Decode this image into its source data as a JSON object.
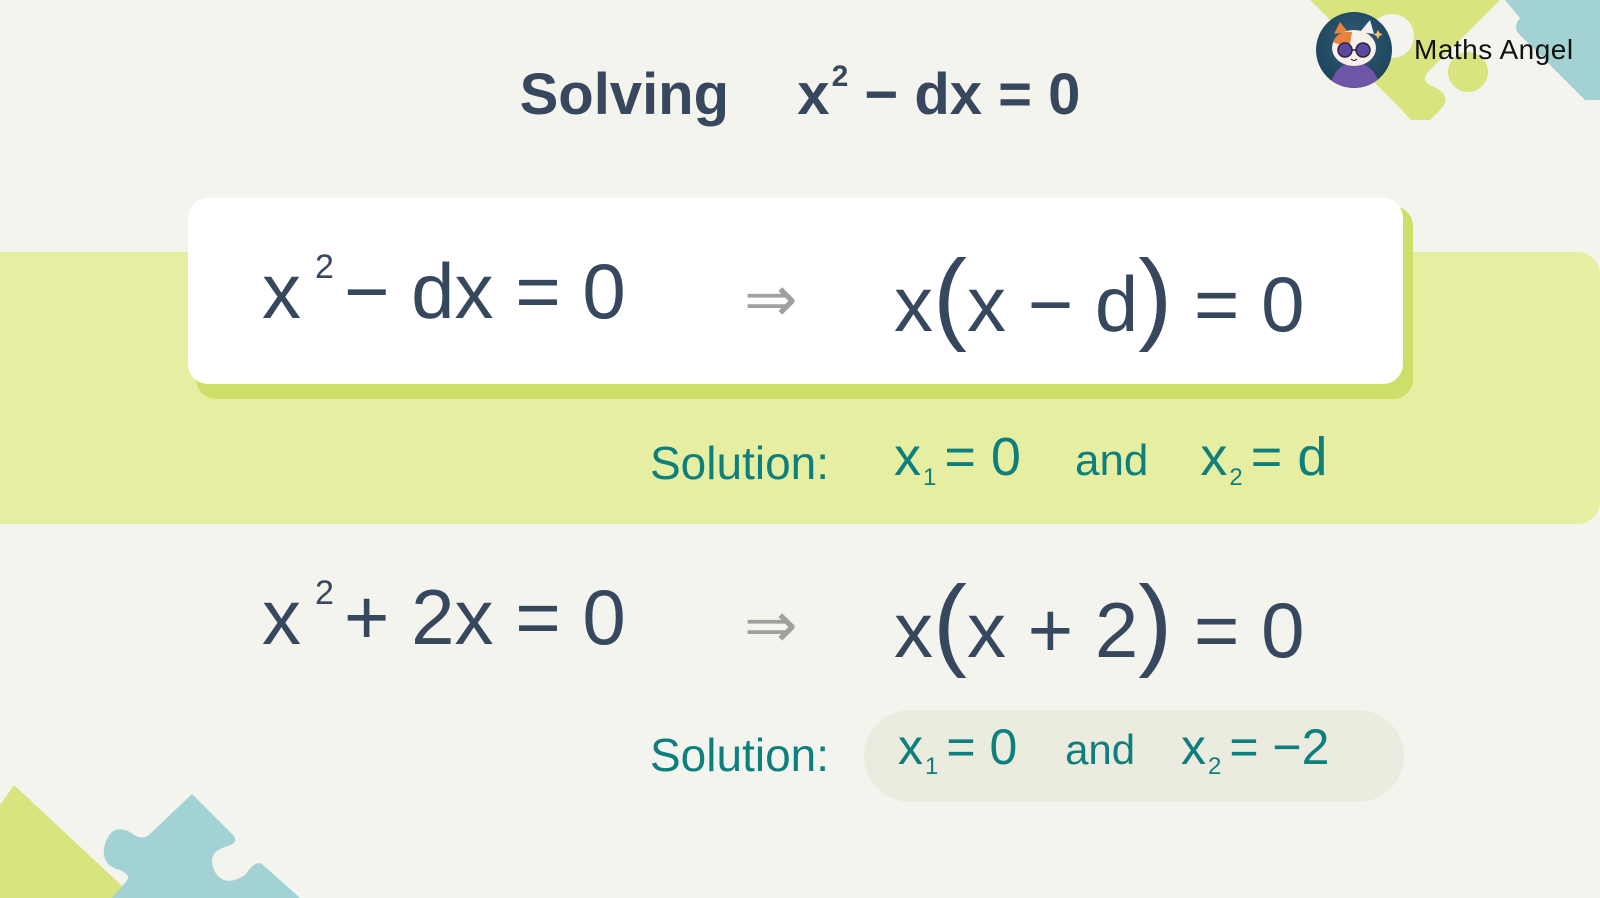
{
  "brand": {
    "name": "Maths Angel",
    "logo_icon": "cat-with-sunglasses-avatar"
  },
  "title": {
    "prefix": "Solving",
    "equation_base": "x",
    "exponent": "2",
    "equation_rest": "− dx = 0"
  },
  "examples": [
    {
      "lhs_base": "x",
      "lhs_exponent": "2",
      "lhs_rest": "− dx = 0",
      "arrow": "⇒",
      "factored_outer": "x",
      "factored_open": "(",
      "factored_inner": "x − d",
      "factored_close": ")",
      "factored_rhs": "= 0",
      "solution_label": "Solution:",
      "x1_var": "x",
      "x1_sub": "1",
      "x1_val": "= 0",
      "and": "and",
      "x2_var": "x",
      "x2_sub": "2",
      "x2_val": "= d"
    },
    {
      "lhs_base": "x",
      "lhs_exponent": "2",
      "lhs_rest": "+ 2x = 0",
      "arrow": "⇒",
      "factored_outer": "x",
      "factored_open": "(",
      "factored_inner": "x + 2",
      "factored_close": ")",
      "factored_rhs": "= 0",
      "solution_label": "Solution:",
      "x1_var": "x",
      "x1_sub": "1",
      "x1_val": "= 0",
      "and": "and",
      "x2_var": "x",
      "x2_sub": "2",
      "x2_val": "= −2"
    }
  ],
  "colors": {
    "background": "#f4f4ee",
    "text_dark": "#37475e",
    "solution_teal": "#0e7f7c",
    "highlight_band": "#e6efa1",
    "card_shadow": "#cddf68",
    "puzzle_green": "#d9e47f",
    "puzzle_blue": "#a2d2d3",
    "arrow_gray": "#a0a0a0"
  }
}
